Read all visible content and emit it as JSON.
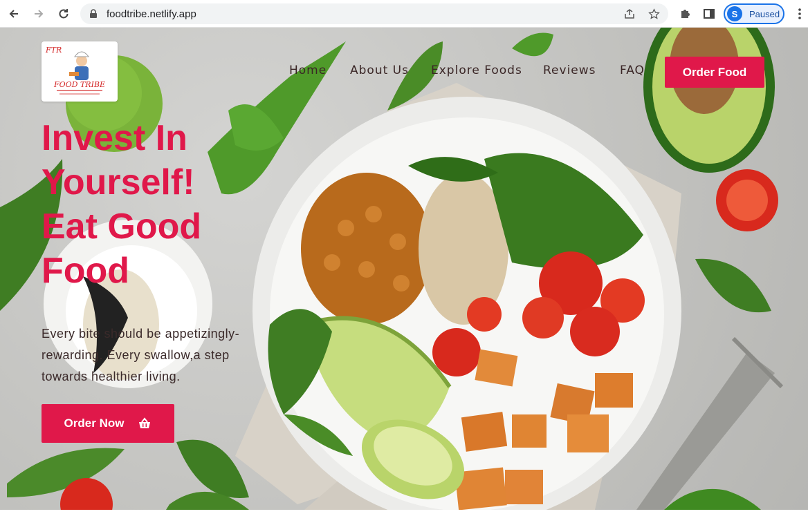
{
  "browser": {
    "url": "foodtribe.netlify.app",
    "profile_initial": "S",
    "profile_status": "Paused"
  },
  "site": {
    "logo_alt": "FOOD TRIBE",
    "nav": [
      "Home",
      "About Us",
      "Explore Foods",
      "Reviews",
      "FAQ"
    ],
    "cta_label": "Order Food"
  },
  "hero": {
    "headline_lines": [
      "Invest In",
      "Yourself!",
      "Eat Good",
      "Food"
    ],
    "tagline": "Every bite should be appetizingly-rewarding. Every swallow,a step towards healthier living.",
    "button_label": "Order Now",
    "button_icon": "basket-icon"
  },
  "colors": {
    "accent": "#e0184a",
    "nav_text": "#3a2626"
  }
}
